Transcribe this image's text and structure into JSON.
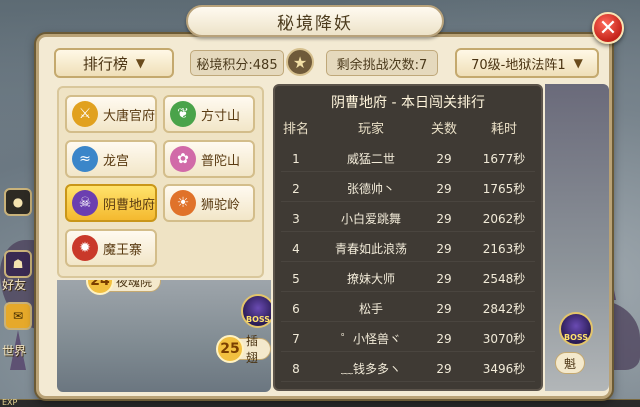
{
  "panel": {
    "title": "秘境降妖",
    "close_glyph": "✕"
  },
  "controls": {
    "ranking_dropdown": "排行榜",
    "score_label": "秘境积分:485",
    "remaining_label": "剩余挑战次数:7",
    "level_dropdown": "70级-地狱法阵1"
  },
  "schools": [
    {
      "name": "大唐官府",
      "icon": "sword-emblem-icon",
      "color": "#e1a11f",
      "glyph": "⚔",
      "active": false
    },
    {
      "name": "方寸山",
      "icon": "leaf-emblem-icon",
      "color": "#4aa34a",
      "glyph": "❦",
      "active": false
    },
    {
      "name": "龙宫",
      "icon": "wave-emblem-icon",
      "color": "#3b86c9",
      "glyph": "≈",
      "active": false
    },
    {
      "name": "普陀山",
      "icon": "lotus-emblem-icon",
      "color": "#d16aa8",
      "glyph": "✿",
      "active": false
    },
    {
      "name": "阴曹地府",
      "icon": "skull-emblem-icon",
      "color": "#6b3fb0",
      "glyph": "☠",
      "active": true
    },
    {
      "name": "狮驼岭",
      "icon": "lion-emblem-icon",
      "color": "#e0722a",
      "glyph": "☀",
      "active": false
    },
    {
      "name": "魔王寨",
      "icon": "demon-emblem-icon",
      "color": "#c9392a",
      "glyph": "✹",
      "active": false
    }
  ],
  "ranking": {
    "title": "阴曹地府 - 本日闯关排行",
    "headers": {
      "rank": "排名",
      "player": "玩家",
      "passes": "关数",
      "time": "耗时"
    },
    "rows": [
      {
        "rank": "1",
        "player": "威猛二世",
        "passes": "29",
        "time": "1677秒"
      },
      {
        "rank": "2",
        "player": "张德帅丶",
        "passes": "29",
        "time": "1765秒"
      },
      {
        "rank": "3",
        "player": "小白爱跳舞",
        "passes": "29",
        "time": "2062秒"
      },
      {
        "rank": "4",
        "player": "青春如此浪荡",
        "passes": "29",
        "time": "2163秒"
      },
      {
        "rank": "5",
        "player": "撩妹大师",
        "passes": "29",
        "time": "2548秒"
      },
      {
        "rank": "6",
        "player": "松手",
        "passes": "29",
        "time": "2842秒"
      },
      {
        "rank": "7",
        "player": "゜小怪兽ヾ",
        "passes": "29",
        "time": "3070秒"
      },
      {
        "rank": "8",
        "player": "﹏钱多多ヽ",
        "passes": "29",
        "time": "3496秒"
      }
    ]
  },
  "map": {
    "stage_25_num": "25",
    "stage_25_label": "插翅",
    "stage_24_num": "24",
    "stage_24_label": "夜魂院",
    "boss_label": "BOSS",
    "right_stage_label": "魁"
  },
  "hud": {
    "friends": "好友",
    "world": "世界",
    "exp": "EXP"
  }
}
